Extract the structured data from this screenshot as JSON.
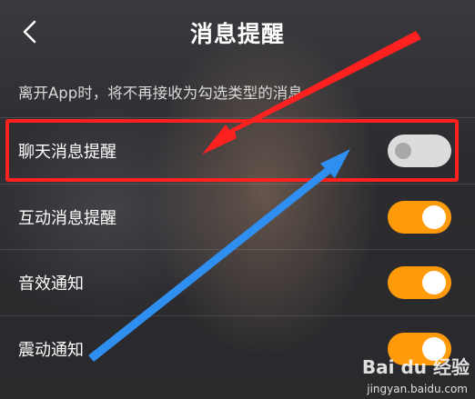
{
  "header": {
    "title": "消息提醒"
  },
  "description": "离开App时，将不再接收为勾选类型的消息",
  "settings": [
    {
      "label": "聊天消息提醒",
      "enabled": false
    },
    {
      "label": "互动消息提醒",
      "enabled": true
    },
    {
      "label": "音效通知",
      "enabled": true
    },
    {
      "label": "震动通知",
      "enabled": true
    }
  ],
  "annotations": {
    "highlight_color": "#ff2020",
    "arrow_colors": [
      "#ff2020",
      "#2f8ff0"
    ]
  },
  "colors": {
    "toggle_on": "#ff9a0a",
    "toggle_off": "#dcdcdc"
  },
  "watermark": {
    "brand": "Bai du 经验",
    "url": "jingyan.baidu.com"
  }
}
